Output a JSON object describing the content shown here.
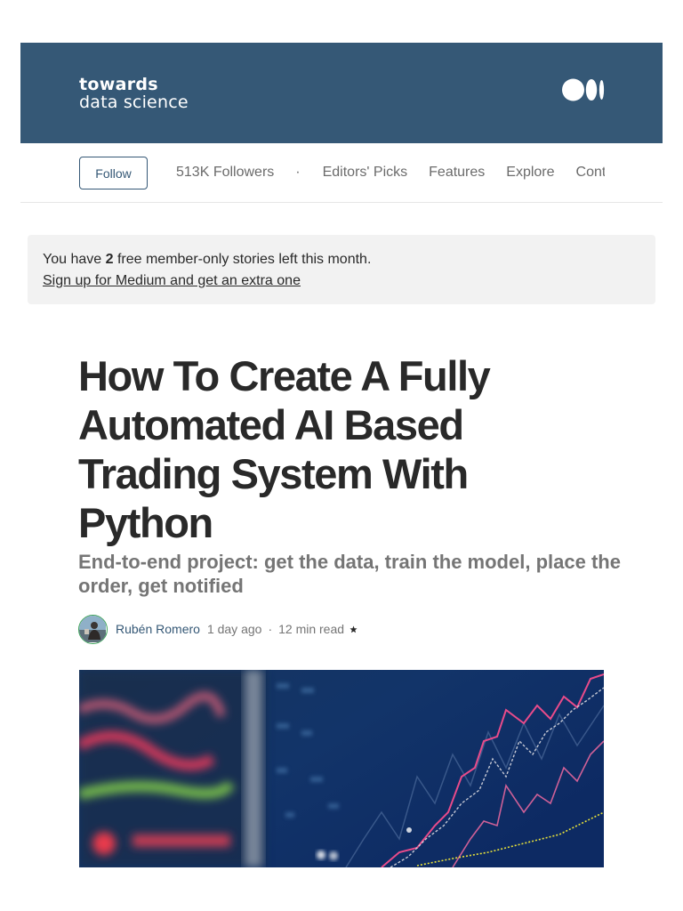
{
  "publication": {
    "logo_line1": "towards",
    "logo_line2": "data science",
    "banner_color": "#355876",
    "medium_logo_icon": "medium-logo-icon"
  },
  "nav": {
    "follow_label": "Follow",
    "followers": "513K Followers",
    "separator": "·",
    "items": [
      "Editors' Picks",
      "Features",
      "Explore",
      "Contribute"
    ]
  },
  "paywall": {
    "prefix": "You have ",
    "count": "2",
    "suffix": " free member-only stories left this month.",
    "link": "Sign up for Medium and get an extra one"
  },
  "article": {
    "title": "How To Create A Fully Automated AI Based Trading System With Python",
    "subtitle": "End-to-end project: get the data, train the model, place the order, get notified",
    "author": "Rubén Romero",
    "published": "1 day ago",
    "separator": "·",
    "read_time": "12 min read",
    "member_icon": "star-icon",
    "accent_color": "#355876"
  }
}
